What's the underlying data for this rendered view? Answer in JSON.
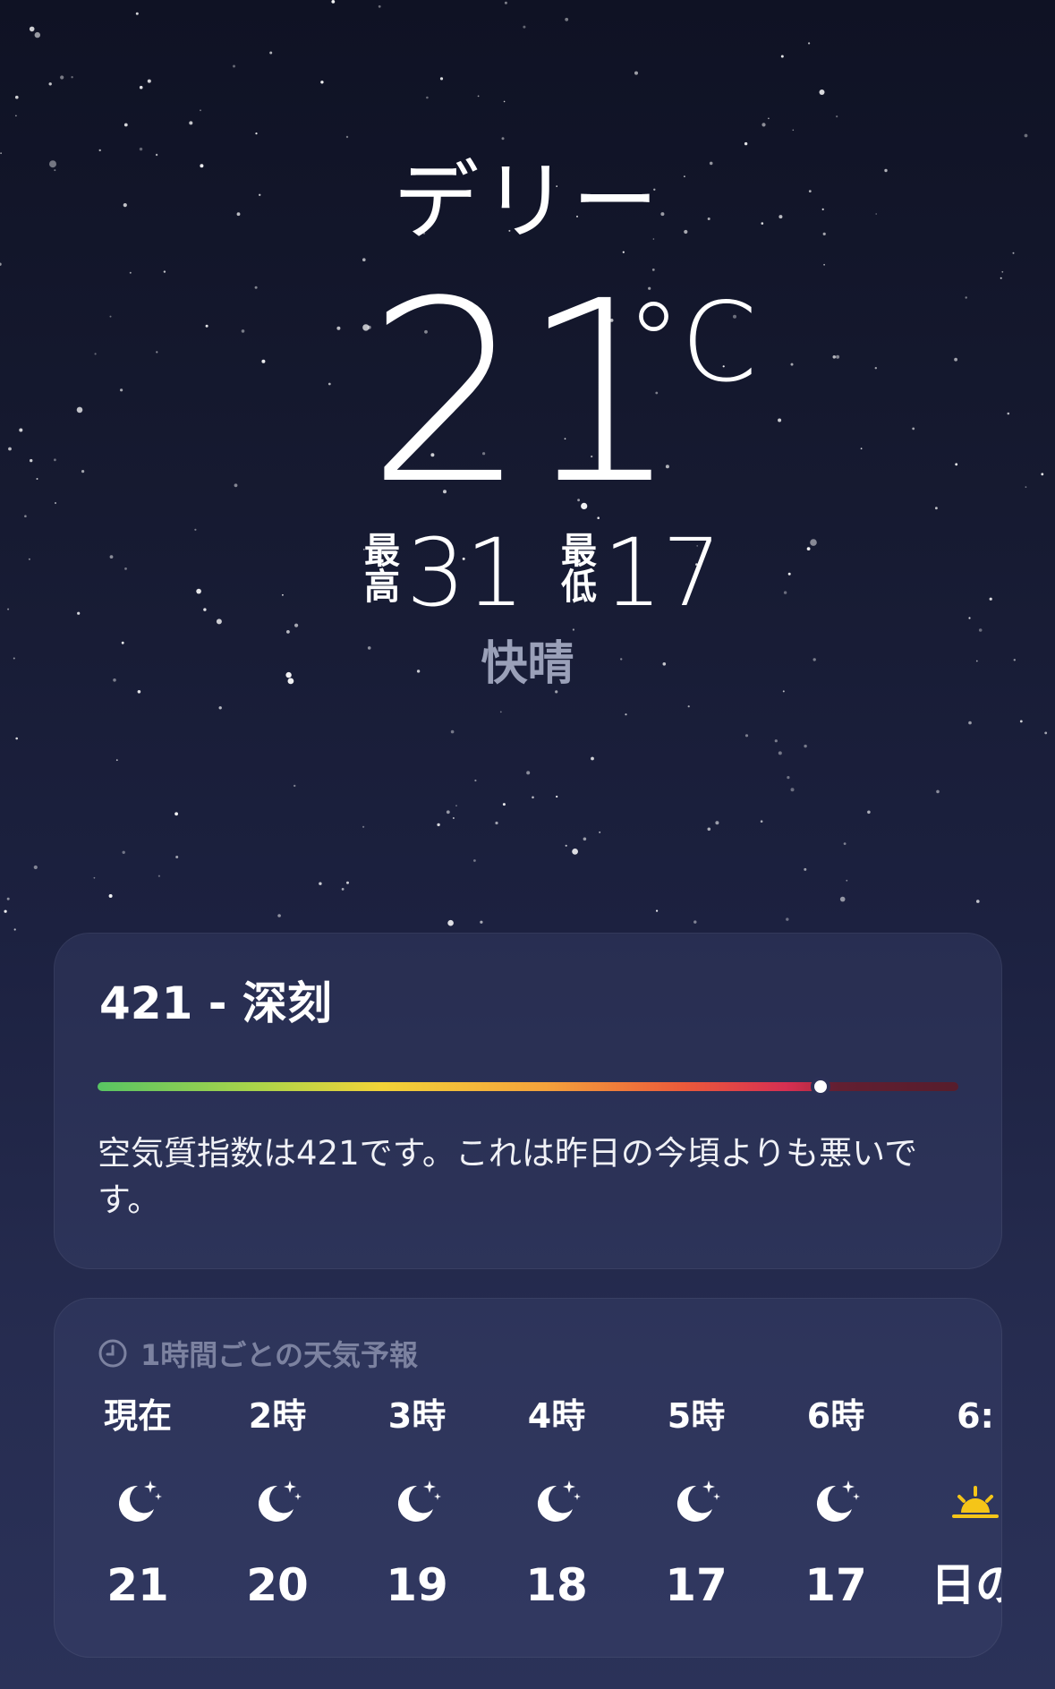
{
  "location": {
    "city": "デリー",
    "current_temp": "21",
    "unit": "°C",
    "high_label": "最高",
    "high_value": "31",
    "low_label": "最低",
    "low_value": "17",
    "condition": "快晴"
  },
  "air_quality": {
    "title": "421 - 深刻",
    "index": 421,
    "scale_position": 0.84,
    "description": "空気質指数は421です。これは昨日の今頃よりも悪いです。",
    "gradient_colors": [
      "#58c463",
      "#f3d338",
      "#f4a23b",
      "#ec5a3a",
      "#d72f52",
      "#8d2530"
    ]
  },
  "hourly": {
    "header": "1時間ごとの天気予報",
    "header_icon": "clock-icon",
    "items": [
      {
        "label": "現在",
        "icon": "moon-stars-icon",
        "temp": "21"
      },
      {
        "label": "2時",
        "icon": "moon-stars-icon",
        "temp": "20"
      },
      {
        "label": "3時",
        "icon": "moon-stars-icon",
        "temp": "19"
      },
      {
        "label": "4時",
        "icon": "moon-stars-icon",
        "temp": "18"
      },
      {
        "label": "5時",
        "icon": "moon-stars-icon",
        "temp": "17"
      },
      {
        "label": "6時",
        "icon": "moon-stars-icon",
        "temp": "17"
      },
      {
        "label": "6:",
        "icon": "sunrise-icon",
        "temp": "日の"
      }
    ]
  },
  "colors": {
    "condition_text": "#9aa0b8",
    "sunrise_accent": "#f5c518"
  }
}
